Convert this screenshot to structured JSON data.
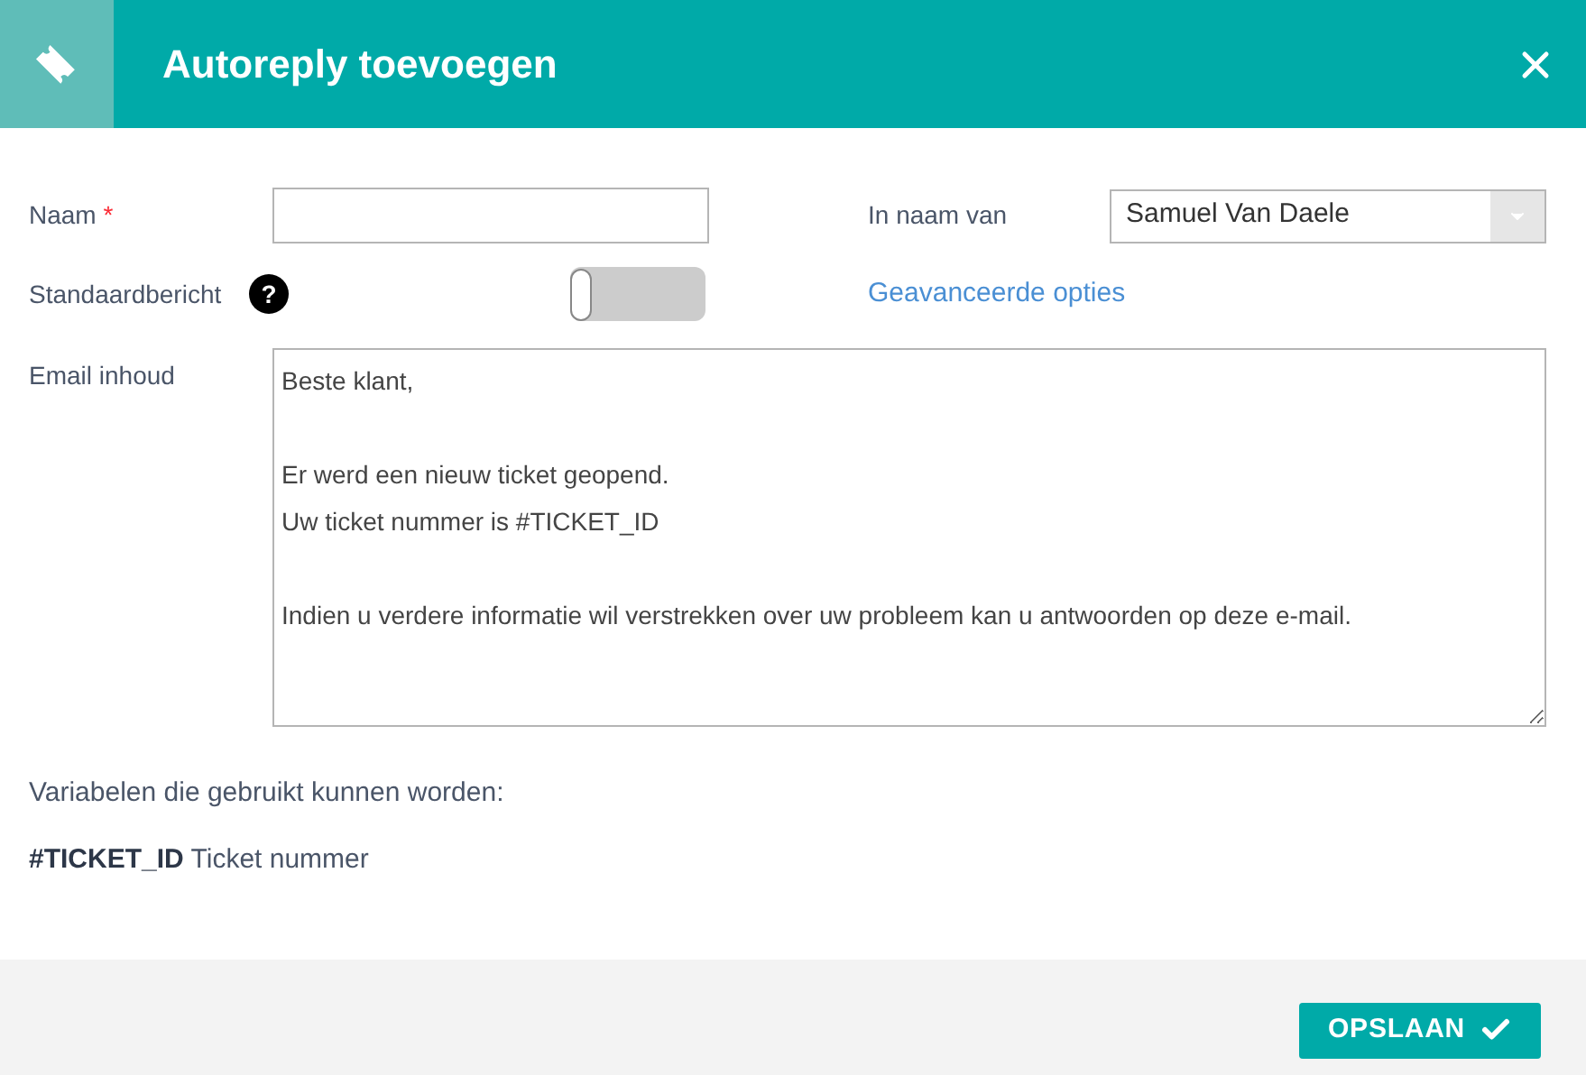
{
  "header": {
    "title": "Autoreply toevoegen"
  },
  "form": {
    "name_label": "Naam",
    "name_required_mark": "*",
    "on_behalf_label": "In naam van",
    "on_behalf_value": "Samuel Van Daele",
    "default_label": "Standaardbericht",
    "default_help": "?",
    "default_on": false,
    "advanced_link": "Geavanceerde opties",
    "content_label": "Email inhoud",
    "content_paragraphs": [
      [
        "Beste klant,"
      ],
      [
        "Er werd een nieuw ticket geopend.",
        "Uw ticket nummer is #TICKET_ID"
      ],
      [
        "Indien u verdere informatie wil verstrekken over uw probleem kan u antwoorden op deze e-mail."
      ]
    ]
  },
  "variables": {
    "heading": "Variabelen die gebruikt kunnen worden:",
    "items": [
      "**#TICKET_ID** Ticket nummer"
    ]
  },
  "footer": {
    "save_button": "OPSLAAN"
  }
}
